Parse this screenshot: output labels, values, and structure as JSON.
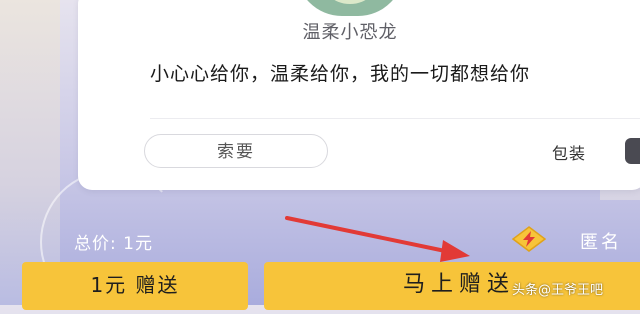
{
  "gift": {
    "name": "温柔小恐龙",
    "description": "小心心给你，温柔给你，我的一切都想给你"
  },
  "actions": {
    "ask_label": "索要",
    "pack_label": "包装"
  },
  "footer": {
    "total_price": "总价: 1元",
    "anonymous_label": "匿名",
    "gift_1_label": "1元 赠送",
    "gift_now_label": "马上赠送"
  },
  "watermark": {
    "text": "头条@王爷王吧"
  },
  "icons": {
    "pack": "gift-box-icon",
    "anonymous": "lightning-badge-icon",
    "annotation": "red-arrow-annotation"
  },
  "colors": {
    "button_yellow": "#f7c43a",
    "arrow_red": "#e23a36",
    "dino_green": "#8fb9a0"
  }
}
